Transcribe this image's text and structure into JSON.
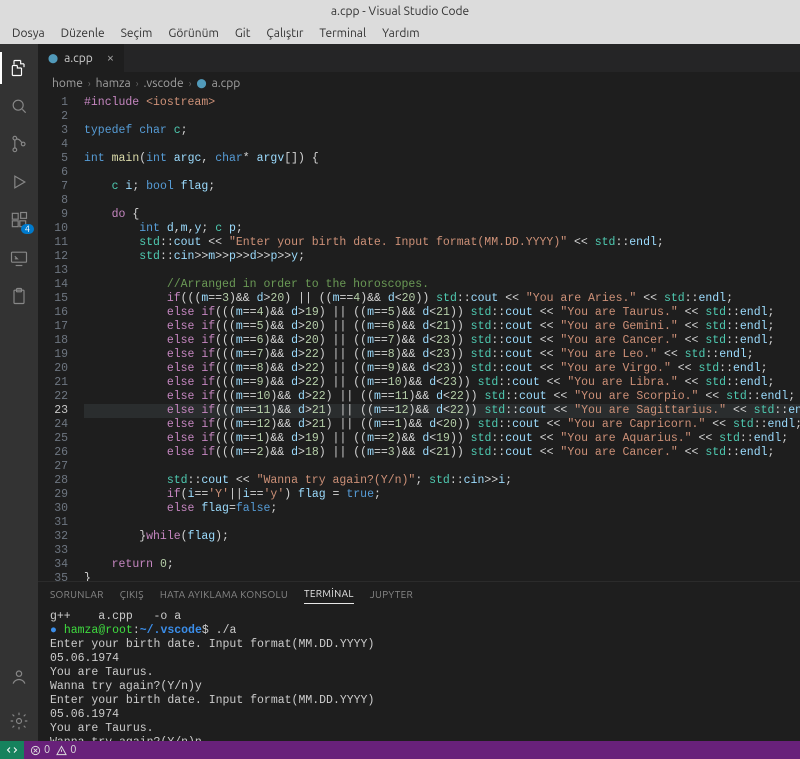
{
  "title": "a.cpp - Visual Studio Code",
  "menu": {
    "items": [
      "Dosya",
      "Düzenle",
      "Seçim",
      "Görünüm",
      "Git",
      "Çalıştır",
      "Terminal",
      "Yardım"
    ]
  },
  "activity": {
    "badge": "4"
  },
  "tab": {
    "label": "a.cpp",
    "close": "×"
  },
  "breadcrumbs": {
    "items": [
      "home",
      "hamza",
      ".vscode",
      "a.cpp"
    ]
  },
  "editor": {
    "line_count": 35,
    "current_line": 23
  },
  "code": {
    "l1": {
      "a": "#include",
      "b": " <iostream>"
    },
    "l3": {
      "a": "typedef",
      "b": "char",
      "c": "c",
      "d": ";"
    },
    "l5": {
      "a": "int",
      "b": "main",
      "c": "(",
      "d": "int",
      "e": "argc",
      "f": ", ",
      "g": "char",
      "h": "* ",
      "i": "argv",
      "j": "[]) {"
    },
    "l7": {
      "a": "c",
      "b": "i",
      "c": "; ",
      "d": "bool",
      "e": "flag",
      "f": ";"
    },
    "l9": {
      "a": "do",
      "b": " {"
    },
    "l10": {
      "a": "int",
      "b": "d",
      "c": ",",
      "d": "m",
      "e": ",",
      "f": "y",
      "g": "; ",
      "h": "c",
      "i": "p",
      "j": ";"
    },
    "l11": {
      "a": "std",
      "b": "::",
      "c": "cout",
      "d": " << ",
      "e": "\"Enter your birth date. Input format(MM.DD.YYYY)\"",
      "f": " << ",
      "g": "std",
      "h": "::",
      "i": "endl",
      "j": ";"
    },
    "l12": {
      "a": "std",
      "b": "::",
      "c": "cin",
      "d": ">>",
      "e": "m",
      "f": ">>",
      "g": "p",
      "h": ">>",
      "i": "d",
      "j": ">>",
      "k": "p",
      "l": ">>",
      "m": "y",
      "n": ";"
    },
    "l14": "//Arranged in order to the horoscopes.",
    "horo": [
      {
        "else": false,
        "m1": "3",
        "c1": ">",
        "v1": "20",
        "m2": "4",
        "c2": "<",
        "v2": "20",
        "msg": "\"You are Aries.\""
      },
      {
        "else": true,
        "m1": "4",
        "c1": ">",
        "v1": "19",
        "m2": "5",
        "c2": "<",
        "v2": "21",
        "msg": "\"You are Taurus.\""
      },
      {
        "else": true,
        "m1": "5",
        "c1": ">",
        "v1": "20",
        "m2": "6",
        "c2": "<",
        "v2": "21",
        "msg": "\"You are Gemini.\""
      },
      {
        "else": true,
        "m1": "6",
        "c1": ">",
        "v1": "20",
        "m2": "7",
        "c2": "<",
        "v2": "23",
        "msg": "\"You are Cancer.\""
      },
      {
        "else": true,
        "m1": "7",
        "c1": ">",
        "v1": "22",
        "m2": "8",
        "c2": "<",
        "v2": "23",
        "msg": "\"You are Leo.\""
      },
      {
        "else": true,
        "m1": "8",
        "c1": ">",
        "v1": "22",
        "m2": "9",
        "c2": "<",
        "v2": "23",
        "msg": "\"You are Virgo.\""
      },
      {
        "else": true,
        "m1": "9",
        "c1": ">",
        "v1": "22",
        "m2": "10",
        "c2": "<",
        "v2": "23",
        "msg": "\"You are Libra.\""
      },
      {
        "else": true,
        "m1": "10",
        "c1": ">",
        "v1": "22",
        "m2": "11",
        "c2": "<",
        "v2": "22",
        "msg": "\"You are Scorpio.\""
      },
      {
        "else": true,
        "m1": "11",
        "c1": ">",
        "v1": "21",
        "m2": "12",
        "c2": "<",
        "v2": "22",
        "msg": "\"You are Sagittarius.\""
      },
      {
        "else": true,
        "m1": "12",
        "c1": ">",
        "v1": "21",
        "m2": "1",
        "c2": "<",
        "v2": "20",
        "msg": "\"You are Capricorn.\""
      },
      {
        "else": true,
        "m1": "1",
        "c1": ">",
        "v1": "19",
        "m2": "2",
        "c2": "<",
        "v2": "19",
        "msg": "\"You are Aquarius.\""
      },
      {
        "else": true,
        "m1": "2",
        "c1": ">",
        "v1": "18",
        "m2": "3",
        "c2": "<",
        "v2": "21",
        "msg": "\"You are Cancer.\""
      }
    ],
    "l28": {
      "a": "std",
      "b": "::",
      "c": "cout",
      "d": " << ",
      "e": "\"Wanna try again?(Y/n)\"",
      "f": "; ",
      "g": "std",
      "h": "::",
      "i": "cin",
      "j": ">>",
      "k": "i",
      "l": ";"
    },
    "l29": {
      "a": "if",
      "b": "(",
      "c": "i",
      "d": "==",
      "e": "'Y'",
      "f": "||",
      "g": "i",
      "h": "==",
      "i": "'y'",
      "j": ") ",
      "k": "flag",
      "l": " = ",
      "m": "true",
      "n": ";"
    },
    "l30": {
      "a": "else",
      "b": " ",
      "c": "flag",
      "d": "=",
      "e": "false",
      "f": ";"
    },
    "l32": {
      "a": "}",
      "b": "while",
      "c": "(",
      "d": "flag",
      "e": ");"
    },
    "l34": {
      "a": "return",
      "b": " ",
      "c": "0",
      "d": ";"
    },
    "l35": "}"
  },
  "panel": {
    "tabs": [
      "SORUNLAR",
      "ÇIKIŞ",
      "HATA AYIKLAMA KONSOLU",
      "TERMİNAL",
      "JUPYTER"
    ],
    "active_tab": "TERMİNAL"
  },
  "terminal": {
    "l1": "g++    a.cpp   -o a",
    "prompt_user": "hamza@root",
    "prompt_path": "~/.vscode",
    "prompt_sep1": ":",
    "prompt_sep2": "$",
    "cmd1": " ./a",
    "out1": "Enter your birth date. Input format(MM.DD.YYYY)",
    "out2": "05.06.1974",
    "out3": "You are Taurus.",
    "out4": "Wanna try again?(Y/n)y",
    "out5": "Enter your birth date. Input format(MM.DD.YYYY)",
    "out6": "05.06.1974",
    "out7": "You are Taurus.",
    "out8": "Wanna try again?(Y/n)n"
  },
  "status": {
    "errors": "0",
    "warnings": "0"
  }
}
